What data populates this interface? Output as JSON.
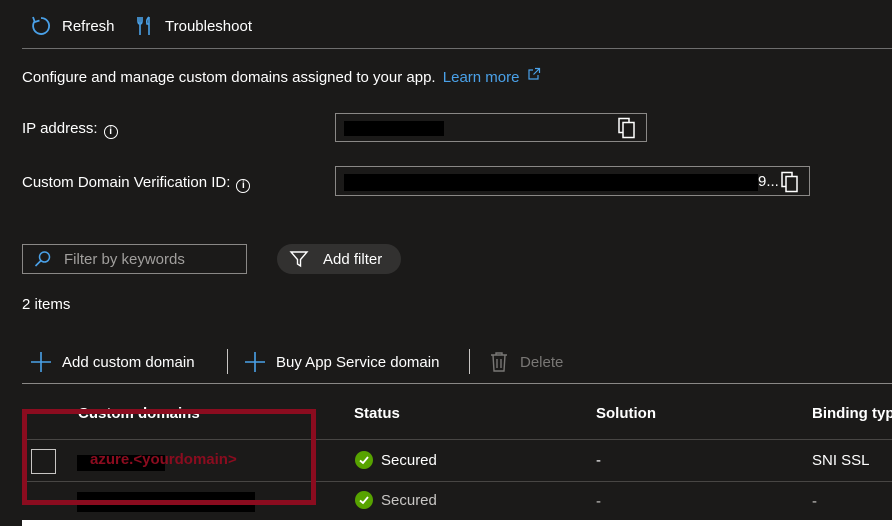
{
  "toolbar": {
    "refresh_label": "Refresh",
    "troubleshoot_label": "Troubleshoot"
  },
  "intro": {
    "text": "Configure and manage custom domains assigned to your app.",
    "learn_more": "Learn more"
  },
  "fields": {
    "ip_label": "IP address:",
    "verification_label": "Custom Domain Verification ID:",
    "verification_suffix": "9..."
  },
  "filter": {
    "placeholder": "Filter by keywords",
    "add_filter_label": "Add filter"
  },
  "item_count": "2 items",
  "actions": {
    "add_custom_domain": "Add custom domain",
    "buy_domain": "Buy App Service domain",
    "delete": "Delete"
  },
  "table": {
    "headers": [
      "Custom domains",
      "Status",
      "Solution",
      "Binding typ"
    ],
    "rows": [
      {
        "domain": "azure.<yourdomain>",
        "status": "Secured",
        "solution": "-",
        "binding": "SNI SSL"
      },
      {
        "domain": "",
        "status": "Secured",
        "solution": "-",
        "binding": "-"
      }
    ]
  },
  "colors": {
    "accent": "#4aa1e8",
    "success": "#57a300",
    "annotation_red": "#8b0c1f"
  }
}
